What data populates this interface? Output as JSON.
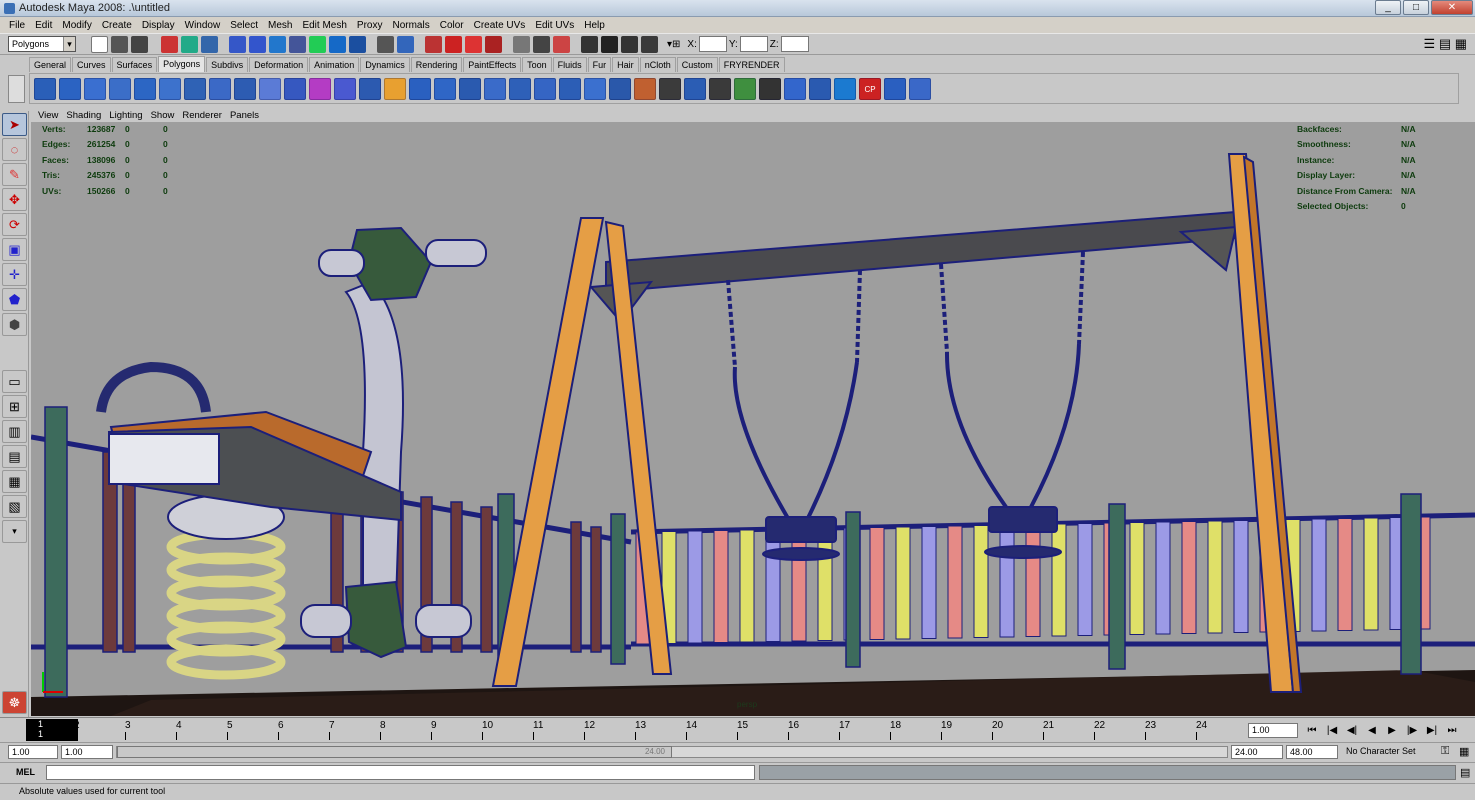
{
  "window": {
    "title": "Autodesk Maya 2008: .\\untitled",
    "min": "_",
    "max": "□",
    "close": "✕"
  },
  "menu": [
    "File",
    "Edit",
    "Modify",
    "Create",
    "Display",
    "Window",
    "Select",
    "Mesh",
    "Edit Mesh",
    "Proxy",
    "Normals",
    "Color",
    "Create UVs",
    "Edit UVs",
    "Help"
  ],
  "status": {
    "mode": "Polygons",
    "x_label": "X:",
    "y_label": "Y:",
    "z_label": "Z:"
  },
  "shelf_tabs": [
    "General",
    "Curves",
    "Surfaces",
    "Polygons",
    "Subdivs",
    "Deformation",
    "Animation",
    "Dynamics",
    "Rendering",
    "PaintEffects",
    "Toon",
    "Fluids",
    "Fur",
    "Hair",
    "nCloth",
    "Custom",
    "FRYRENDER"
  ],
  "shelf_active": "Polygons",
  "shelf_last_icon_label": "CP",
  "panel_menu": [
    "View",
    "Shading",
    "Lighting",
    "Show",
    "Renderer",
    "Panels"
  ],
  "hud_left": [
    {
      "label": "Verts:",
      "a": "123687",
      "b": "0",
      "c": "0"
    },
    {
      "label": "Edges:",
      "a": "261254",
      "b": "0",
      "c": "0"
    },
    {
      "label": "Faces:",
      "a": "138096",
      "b": "0",
      "c": "0"
    },
    {
      "label": "Tris:",
      "a": "245376",
      "b": "0",
      "c": "0"
    },
    {
      "label": "UVs:",
      "a": "150266",
      "b": "0",
      "c": "0"
    }
  ],
  "hud_right": [
    {
      "label": "Backfaces:",
      "value": "N/A"
    },
    {
      "label": "Smoothness:",
      "value": "N/A"
    },
    {
      "label": "Instance:",
      "value": "N/A"
    },
    {
      "label": "Display Layer:",
      "value": "N/A"
    },
    {
      "label": "Distance From Camera:",
      "value": "N/A"
    },
    {
      "label": "Selected Objects:",
      "value": "0"
    }
  ],
  "persp_label": "persp",
  "timeline": {
    "ticks": [
      "2",
      "3",
      "4",
      "5",
      "6",
      "7",
      "8",
      "9",
      "10",
      "11",
      "12",
      "13",
      "14",
      "15",
      "16",
      "17",
      "18",
      "19",
      "20",
      "21",
      "22",
      "23",
      "24"
    ],
    "current": "1",
    "current_frame_field": "1.00"
  },
  "range": {
    "start": "1.00",
    "playback_start": "1.00",
    "playback_end": "24.00",
    "end": "48.00",
    "char_set": "No Character Set",
    "handle_label": "24.00"
  },
  "command": {
    "mel_label": "MEL"
  },
  "help_line": "Absolute values used for current tool",
  "colors": {
    "viewport_bg": "#9e9e9e",
    "wire": "#1c1f7a",
    "post_wood": "#d8953a",
    "slat_colors": [
      "#e58a86",
      "#dfe068",
      "#9c9ae6"
    ]
  }
}
